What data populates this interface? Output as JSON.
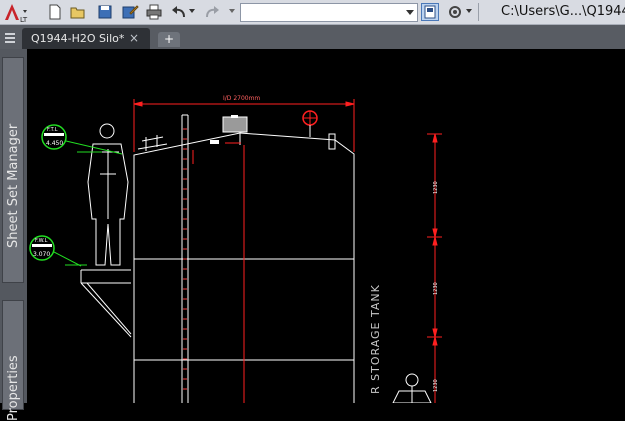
{
  "window": {
    "title": "C:\\Users\\G...\\Q1944",
    "app_logo_letters": "LT"
  },
  "toolbar": {
    "icons": [
      "new-icon",
      "open-icon",
      "save-icon",
      "save-as-icon",
      "plot-icon",
      "undo-icon",
      "redo-icon"
    ],
    "workspace_value": ""
  },
  "tabs": {
    "document": "Q1944-H2O Silo*",
    "close_glyph": "×",
    "new_tab_glyph": "+"
  },
  "palettes": [
    {
      "label": "Sheet Set Manager"
    },
    {
      "label": "Properties"
    }
  ],
  "drawing": {
    "top_dimension": "I/D 2700mm",
    "ftl_label": "F.T.L",
    "ftl_value": "4.450",
    "fwl_label": "F.W.L",
    "fwl_value": "3.070",
    "tank_text": "R STORAGE TANK",
    "dim_1": "1230",
    "dim_2": "1230",
    "dim_3": "1230",
    "colors": {
      "background": "#000000",
      "linework": "#ffffff",
      "dimensions": "#ff2020",
      "level_markers": "#22dd22",
      "text_gray": "#c8c8c8"
    }
  }
}
